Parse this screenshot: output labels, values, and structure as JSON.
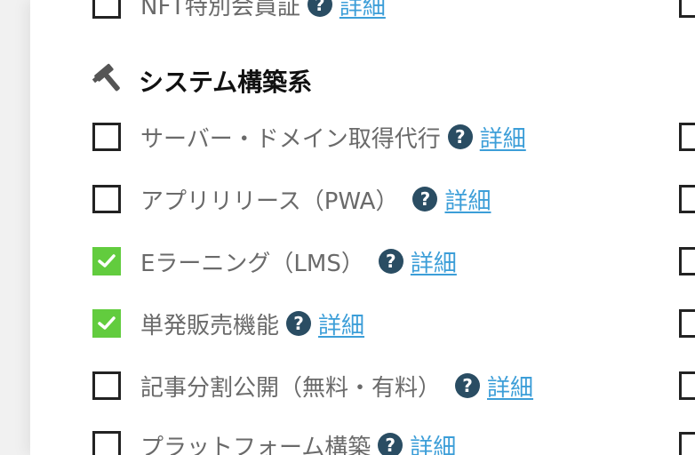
{
  "section": {
    "icon": "hammer-icon",
    "title": "システム構築系"
  },
  "help_icon": "?",
  "prev_item": {
    "label": "NFT特別会員証",
    "link": "詳細",
    "checked": false
  },
  "items": [
    {
      "label": "サーバー・ドメイン取得代行",
      "link": "詳細",
      "checked": false
    },
    {
      "label": "アプリリリース（PWA）",
      "link": "詳細",
      "checked": false
    },
    {
      "label": "Eラーニング（LMS）",
      "link": "詳細",
      "checked": true
    },
    {
      "label": "単発販売機能",
      "link": "詳細",
      "checked": true
    },
    {
      "label": "記事分割公開（無料・有料）",
      "link": "詳細",
      "checked": false
    },
    {
      "label": "プラットフォーム構築",
      "link": "詳細",
      "checked": false
    }
  ],
  "colors": {
    "checkbox_checked": "#62cc3e",
    "help_icon_bg": "#2a4d63",
    "link": "#3c9ed8",
    "label_text": "#6a6a6a"
  }
}
